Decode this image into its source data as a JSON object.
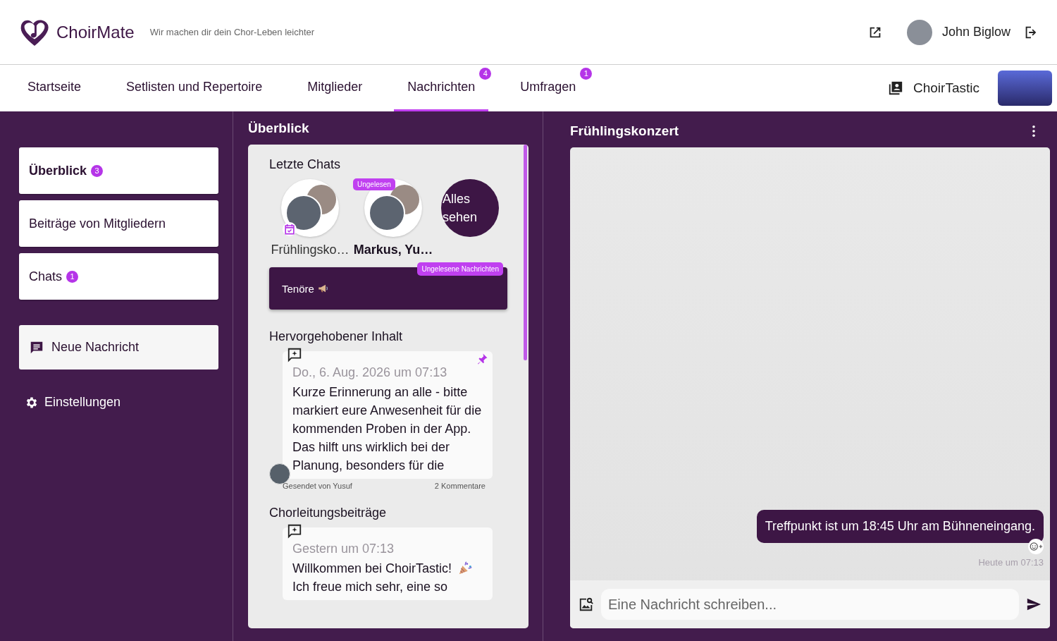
{
  "header": {
    "app_name": "ChoirMate",
    "tagline": "Wir machen dir dein Chor-Leben leichter",
    "user_name": "John Biglow"
  },
  "nav": {
    "tabs": [
      {
        "label": "Startseite",
        "selected": false
      },
      {
        "label": "Setlisten und Repertoire",
        "selected": false
      },
      {
        "label": "Mitglieder",
        "selected": false
      },
      {
        "label": "Nachrichten",
        "selected": true,
        "badge": "4"
      },
      {
        "label": "Umfragen",
        "selected": false,
        "badge": "1"
      }
    ],
    "choir_name": "ChoirTastic"
  },
  "sidebar": {
    "items": [
      {
        "label": "Überblick",
        "selected": true,
        "badge": "3"
      },
      {
        "label": "Beiträge von Mitgliedern",
        "selected": false
      },
      {
        "label": "Chats",
        "selected": false,
        "badge": "1"
      }
    ],
    "new_message_button": "Neue Nachricht",
    "settings": "Einstellungen"
  },
  "overview": {
    "title": "Überblick",
    "recent_heading": "Letzte Chats",
    "chats": [
      {
        "name": "Frühlingsko…",
        "kind": "event",
        "unread": false
      },
      {
        "name": "Markus, Yu…",
        "kind": "direct",
        "unread": true,
        "badge": "Ungelesen"
      }
    ],
    "see_all": "Alles sehen",
    "group": {
      "name": "Tenöre",
      "badge": "Ungelesene Nachrichten"
    },
    "sections": [
      {
        "heading": "Hervorgehobener Inhalt",
        "post": {
          "date": "Do., 6. Aug. 2026 um 07:13",
          "text": "Kurze Erinnerung an alle - bitte markiert eure Anwesenheit für die kommenden Proben in der App. Das hilft uns wirklich bei der Planung, besonders für die",
          "pinned": true,
          "sender": "Gesendet von Yusuf",
          "comments": "2 Kommentare"
        }
      },
      {
        "heading": "Chorleitungsbeiträge",
        "post": {
          "date": "Gestern um 07:13",
          "title": "Willkommen bei ChoirTastic!",
          "text": "Ich freue mich sehr, eine so",
          "pinned": false
        }
      }
    ]
  },
  "chat": {
    "title": "Frühlingskonzert",
    "messages": [
      {
        "text": "Treffpunkt ist um 18:45 Uhr am Bühneneingang.",
        "time": "Heute um 07:13",
        "own": true
      }
    ],
    "input": {
      "placeholder": "Eine Nachricht schreiben..."
    }
  }
}
